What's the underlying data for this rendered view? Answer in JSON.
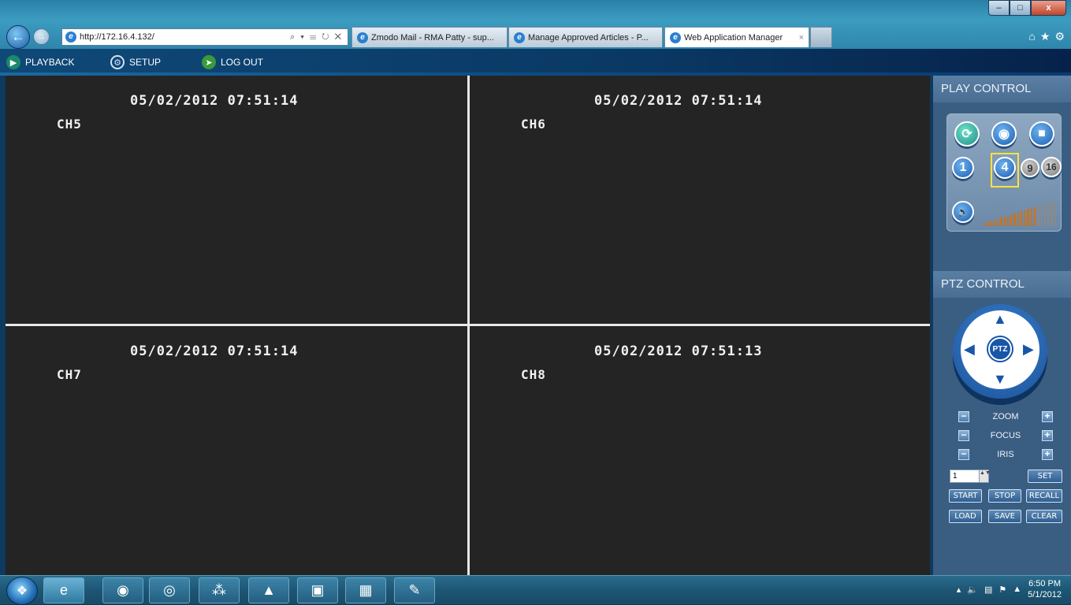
{
  "browser": {
    "address_url": "http://172.16.4.132/",
    "address_tools": "⌕ ▾ ☰ ↻ ✕",
    "tabs": [
      {
        "label": "Zmodo Mail - RMA Patty - sup...",
        "active": false
      },
      {
        "label": "Manage Approved Articles - P...",
        "active": false
      },
      {
        "label": "Web Application Manager",
        "active": true
      }
    ],
    "tab_close": "×",
    "window": {
      "minimize": "–",
      "maximize": "□",
      "close": "x"
    },
    "toolbar_icons": [
      "home-icon",
      "favorites-star-icon",
      "gear-icon"
    ]
  },
  "menu": {
    "playback": "PLAYBACK",
    "setup": "SETUP",
    "logout": "LOG OUT"
  },
  "cameras": [
    {
      "channel": "CH5",
      "timestamp": "05/02/2012 07:51:14"
    },
    {
      "channel": "CH6",
      "timestamp": "05/02/2012 07:51:14"
    },
    {
      "channel": "CH7",
      "timestamp": "05/02/2012 07:51:14"
    },
    {
      "channel": "CH8",
      "timestamp": "05/02/2012 07:51:13"
    }
  ],
  "play_control": {
    "title": "PLAY CONTROL",
    "buttons": [
      "fullscreen-icon",
      "snapshot-icon",
      "record-icon"
    ],
    "layouts": [
      "1",
      "4",
      "9",
      "16"
    ],
    "selected_layout": "4",
    "volume_level": 0.7,
    "bar_colors": {
      "active": "#c8731f",
      "inactive": "#8a8a8a"
    }
  },
  "ptz": {
    "title": "PTZ CONTROL",
    "center_label": "PTZ",
    "zoom": "ZOOM",
    "focus": "FOCUS",
    "iris": "IRIS",
    "minus": "−",
    "plus": "+",
    "preset_value": "1",
    "spin": "▲▼",
    "set": "SET",
    "start": "START",
    "stop": "STOP",
    "recall": "RECALL",
    "load": "LOAD",
    "save": "SAVE",
    "clear": "CLEAR"
  },
  "taskbar": {
    "apps": [
      "internet-explorer-icon",
      "firefox-icon",
      "chrome-icon",
      "network-app-icon",
      "google-drive-icon",
      "remote-desktop-icon",
      "file-explorer-icon",
      "paint-icon"
    ],
    "tray_show_hidden": "▴",
    "time": "6:50 PM",
    "date": "5/1/2012"
  },
  "colors": {
    "accent": "#1856a8",
    "panel": "#3a5d82",
    "video_bg": "#242424"
  }
}
